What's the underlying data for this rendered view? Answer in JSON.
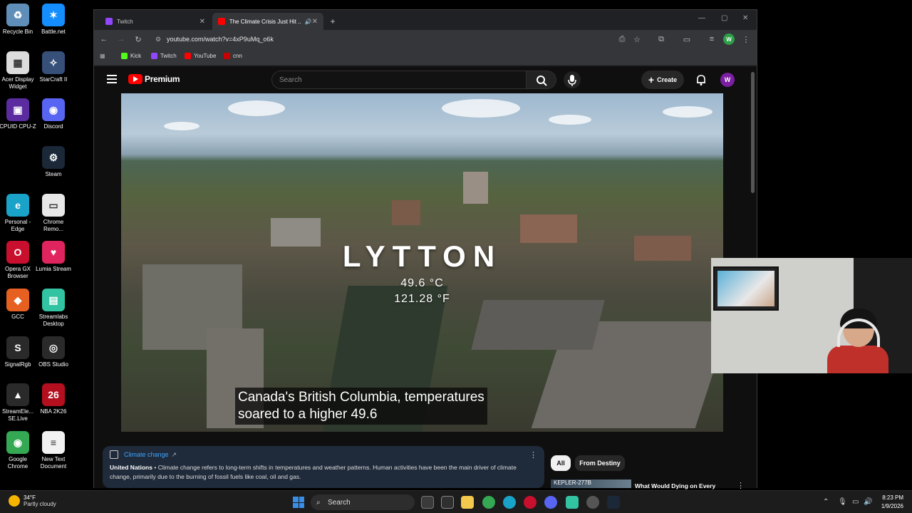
{
  "desktop": {
    "icons": [
      {
        "label": "Recycle Bin",
        "color": "#5f8fb8",
        "glyph": "♻"
      },
      {
        "label": "Battle.net",
        "color": "#148eff",
        "glyph": "✶"
      },
      {
        "label": "Acer Display Widget",
        "color": "#dcdcdc",
        "glyph": "▦"
      },
      {
        "label": "StarCraft II",
        "color": "#36507a",
        "glyph": "✧"
      },
      {
        "label": "CPUID CPU-Z",
        "color": "#5b2ca0",
        "glyph": "▣"
      },
      {
        "label": "Discord",
        "color": "#5865f2",
        "glyph": "◉"
      },
      {
        "label": "Steam",
        "color": "#1b2838",
        "glyph": "⚙"
      },
      {
        "label": "Personal - Edge",
        "color": "#1aa3c9",
        "glyph": "e"
      },
      {
        "label": "Chrome Remo...",
        "color": "#e8e8e8",
        "glyph": "▭"
      },
      {
        "label": "Opera GX Browser",
        "color": "#c8102e",
        "glyph": "O"
      },
      {
        "label": "Lumia Stream",
        "color": "#e0245e",
        "glyph": "♥"
      },
      {
        "label": "GCC",
        "color": "#e66022",
        "glyph": "◆"
      },
      {
        "label": "Streamlabs Desktop",
        "color": "#31c3a2",
        "glyph": "▤"
      },
      {
        "label": "SignalRgb",
        "color": "#2a2a2a",
        "glyph": "S"
      },
      {
        "label": "OBS Studio",
        "color": "#2a2a2a",
        "glyph": "◎"
      },
      {
        "label": "StreamEle... SE.Live",
        "color": "#2a2a2a",
        "glyph": "▲"
      },
      {
        "label": "NBA 2K26",
        "color": "#b40f1e",
        "glyph": "26"
      },
      {
        "label": "Google Chrome",
        "color": "#34a853",
        "glyph": "◉"
      },
      {
        "label": "New Text Document",
        "color": "#f2f2f2",
        "glyph": "≡"
      }
    ]
  },
  "browser": {
    "tabs": [
      {
        "label": "Twitch",
        "fav_color": "#9146ff"
      },
      {
        "label": "The Climate Crisis Just Hit ...",
        "fav_color": "#ff0000"
      }
    ],
    "new_tab_icon": "+",
    "url": "youtube.com/watch?v=4xP9uMq_o6k",
    "bookmarks": [
      {
        "label": "Kick",
        "fav_color": "#53fc18"
      },
      {
        "label": "Twitch",
        "fav_color": "#9146ff"
      },
      {
        "label": "YouTube",
        "fav_color": "#ff0000"
      },
      {
        "label": "cnn",
        "fav_color": "#cc0000"
      }
    ],
    "profile_initial": "W",
    "profile_color": "#2e9e48"
  },
  "youtube": {
    "logo_text": "Premium",
    "search_placeholder": "Search",
    "create_label": "Create",
    "avatar_initial": "W",
    "video": {
      "city": "LYTTON",
      "temp_c": "49.6 °C",
      "temp_f": "121.28 °F",
      "caption_line1": "Canada's British Columbia, temperatures",
      "caption_line2": "soared to a higher 49.6"
    },
    "info_panel": {
      "title": "Climate change",
      "source": "United Nations",
      "body": "• Climate change refers to long-term shifts in temperatures and weather patterns. Human activities have been the main driver of climate change, primarily due to the burning of fossil fuels like coal, oil and gas."
    },
    "chips": [
      "All",
      "From Destiny"
    ],
    "recommendation": {
      "thumb_text": "KEPLER-277B",
      "title": "What Would Dying on Every Planet in the Universe Be Like?"
    }
  },
  "taskbar": {
    "weather_temp": "34°F",
    "weather_desc": "Partly cloudy",
    "search_label": "Search",
    "time": "8:23 PM",
    "date": "1/9/2026"
  }
}
